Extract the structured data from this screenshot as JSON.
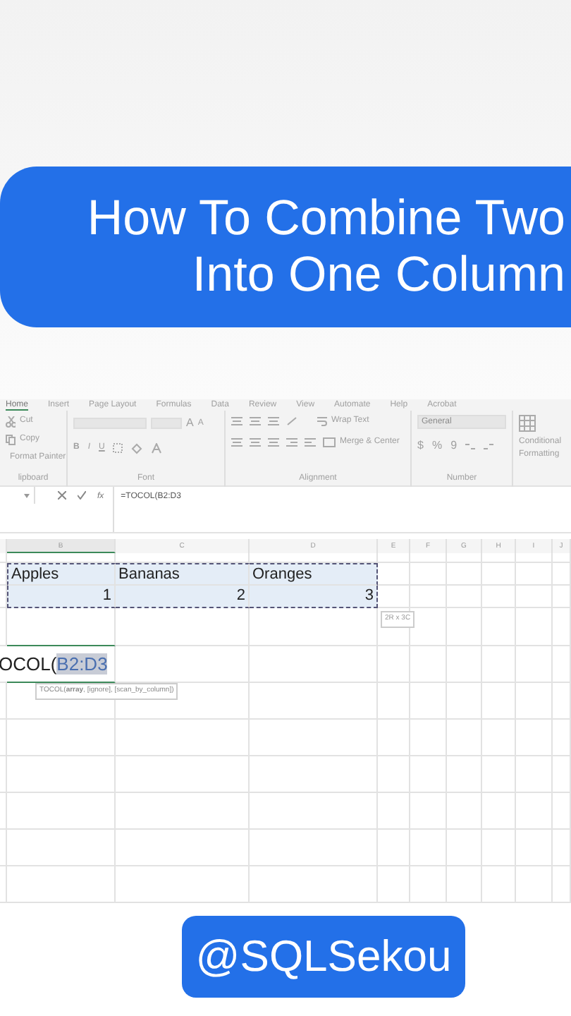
{
  "banner": {
    "lines": [
      "How To Combine Two",
      "Into One Column"
    ]
  },
  "ribbon": {
    "tabs": [
      {
        "label": "Home",
        "selected": true
      },
      {
        "label": "Insert",
        "selected": false
      },
      {
        "label": "Page Layout",
        "selected": false
      },
      {
        "label": "Formulas",
        "selected": false
      },
      {
        "label": "Data",
        "selected": false
      },
      {
        "label": "Review",
        "selected": false
      },
      {
        "label": "View",
        "selected": false
      },
      {
        "label": "Automate",
        "selected": false
      },
      {
        "label": "Help",
        "selected": false
      },
      {
        "label": "Acrobat",
        "selected": false
      }
    ],
    "clipboard": {
      "items": [
        "Cut",
        "Copy",
        "Format Painter"
      ],
      "label": "lipboard"
    },
    "font": {
      "grow_shrink": [
        "A",
        "A"
      ],
      "buttons": [
        "B",
        "I",
        "U"
      ],
      "label": "Font"
    },
    "alignment": {
      "wrap": "Wrap Text",
      "merge": "Merge & Center",
      "label": "Alignment"
    },
    "number": {
      "format": "General",
      "symbols": [
        "$",
        "%",
        "9"
      ],
      "label": "Number"
    },
    "conditional": {
      "lines": [
        "Conditional",
        "Formatting"
      ]
    }
  },
  "formula_bar": {
    "fx": "fx",
    "formula": "=TOCOL(B2:D3"
  },
  "sheet": {
    "columns": [
      "B",
      "C",
      "D",
      "E",
      "F",
      "G",
      "H",
      "I",
      "J"
    ],
    "rows": [
      [
        {
          "text": "Apples",
          "kind": "text",
          "selected": true
        },
        {
          "text": "Bananas",
          "kind": "text",
          "selected": true
        },
        {
          "text": "Oranges",
          "kind": "text",
          "selected": true
        }
      ],
      [
        {
          "text": "1",
          "kind": "number",
          "selected": true
        },
        {
          "text": "2",
          "kind": "number",
          "selected": true
        },
        {
          "text": "3",
          "kind": "number",
          "selected": true
        }
      ]
    ],
    "selection_size": "2R x 3C",
    "editing": {
      "text": "OCOL(",
      "reference": "B2:D3",
      "tooltip": "TOCOL(**array**, [ignore], [scan_by_column])"
    }
  },
  "handle": "@SQLSekou"
}
